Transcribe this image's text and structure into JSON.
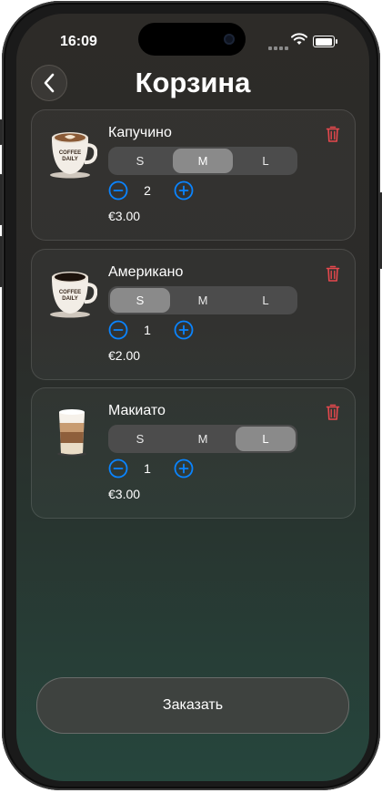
{
  "status": {
    "time": "16:09"
  },
  "header": {
    "title": "Корзина"
  },
  "items": [
    {
      "name": "Капучино",
      "sizes": [
        "S",
        "M",
        "L"
      ],
      "selected": "M",
      "quantity": "2",
      "price": "€3.00",
      "cup_text": "COFFEE DAILY"
    },
    {
      "name": "Американо",
      "sizes": [
        "S",
        "M",
        "L"
      ],
      "selected": "S",
      "quantity": "1",
      "price": "€2.00",
      "cup_text": "COFFEE DAILY"
    },
    {
      "name": "Макиато",
      "sizes": [
        "S",
        "M",
        "L"
      ],
      "selected": "L",
      "quantity": "1",
      "price": "€3.00"
    }
  ],
  "order_button": {
    "label": "Заказать"
  },
  "colors": {
    "accent_blue": "#0a84ff",
    "delete_red": "#e5484d"
  }
}
